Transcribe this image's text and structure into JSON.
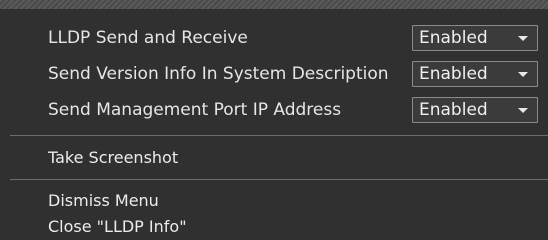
{
  "settings": [
    {
      "label": "LLDP Send and Receive",
      "value": "Enabled"
    },
    {
      "label": "Send Version Info In System Description",
      "value": "Enabled"
    },
    {
      "label": "Send Management Port IP Address",
      "value": "Enabled"
    }
  ],
  "actions": {
    "take_screenshot": "Take Screenshot",
    "dismiss_menu": "Dismiss Menu",
    "close_window": "Close \"LLDP Info\""
  },
  "icons": {
    "dropdown": "chevron-down-icon"
  },
  "colors": {
    "menu_background": "#303030",
    "text": "#ececec",
    "divider": "#6a6a6a",
    "select_border": "#8a8a8a"
  }
}
